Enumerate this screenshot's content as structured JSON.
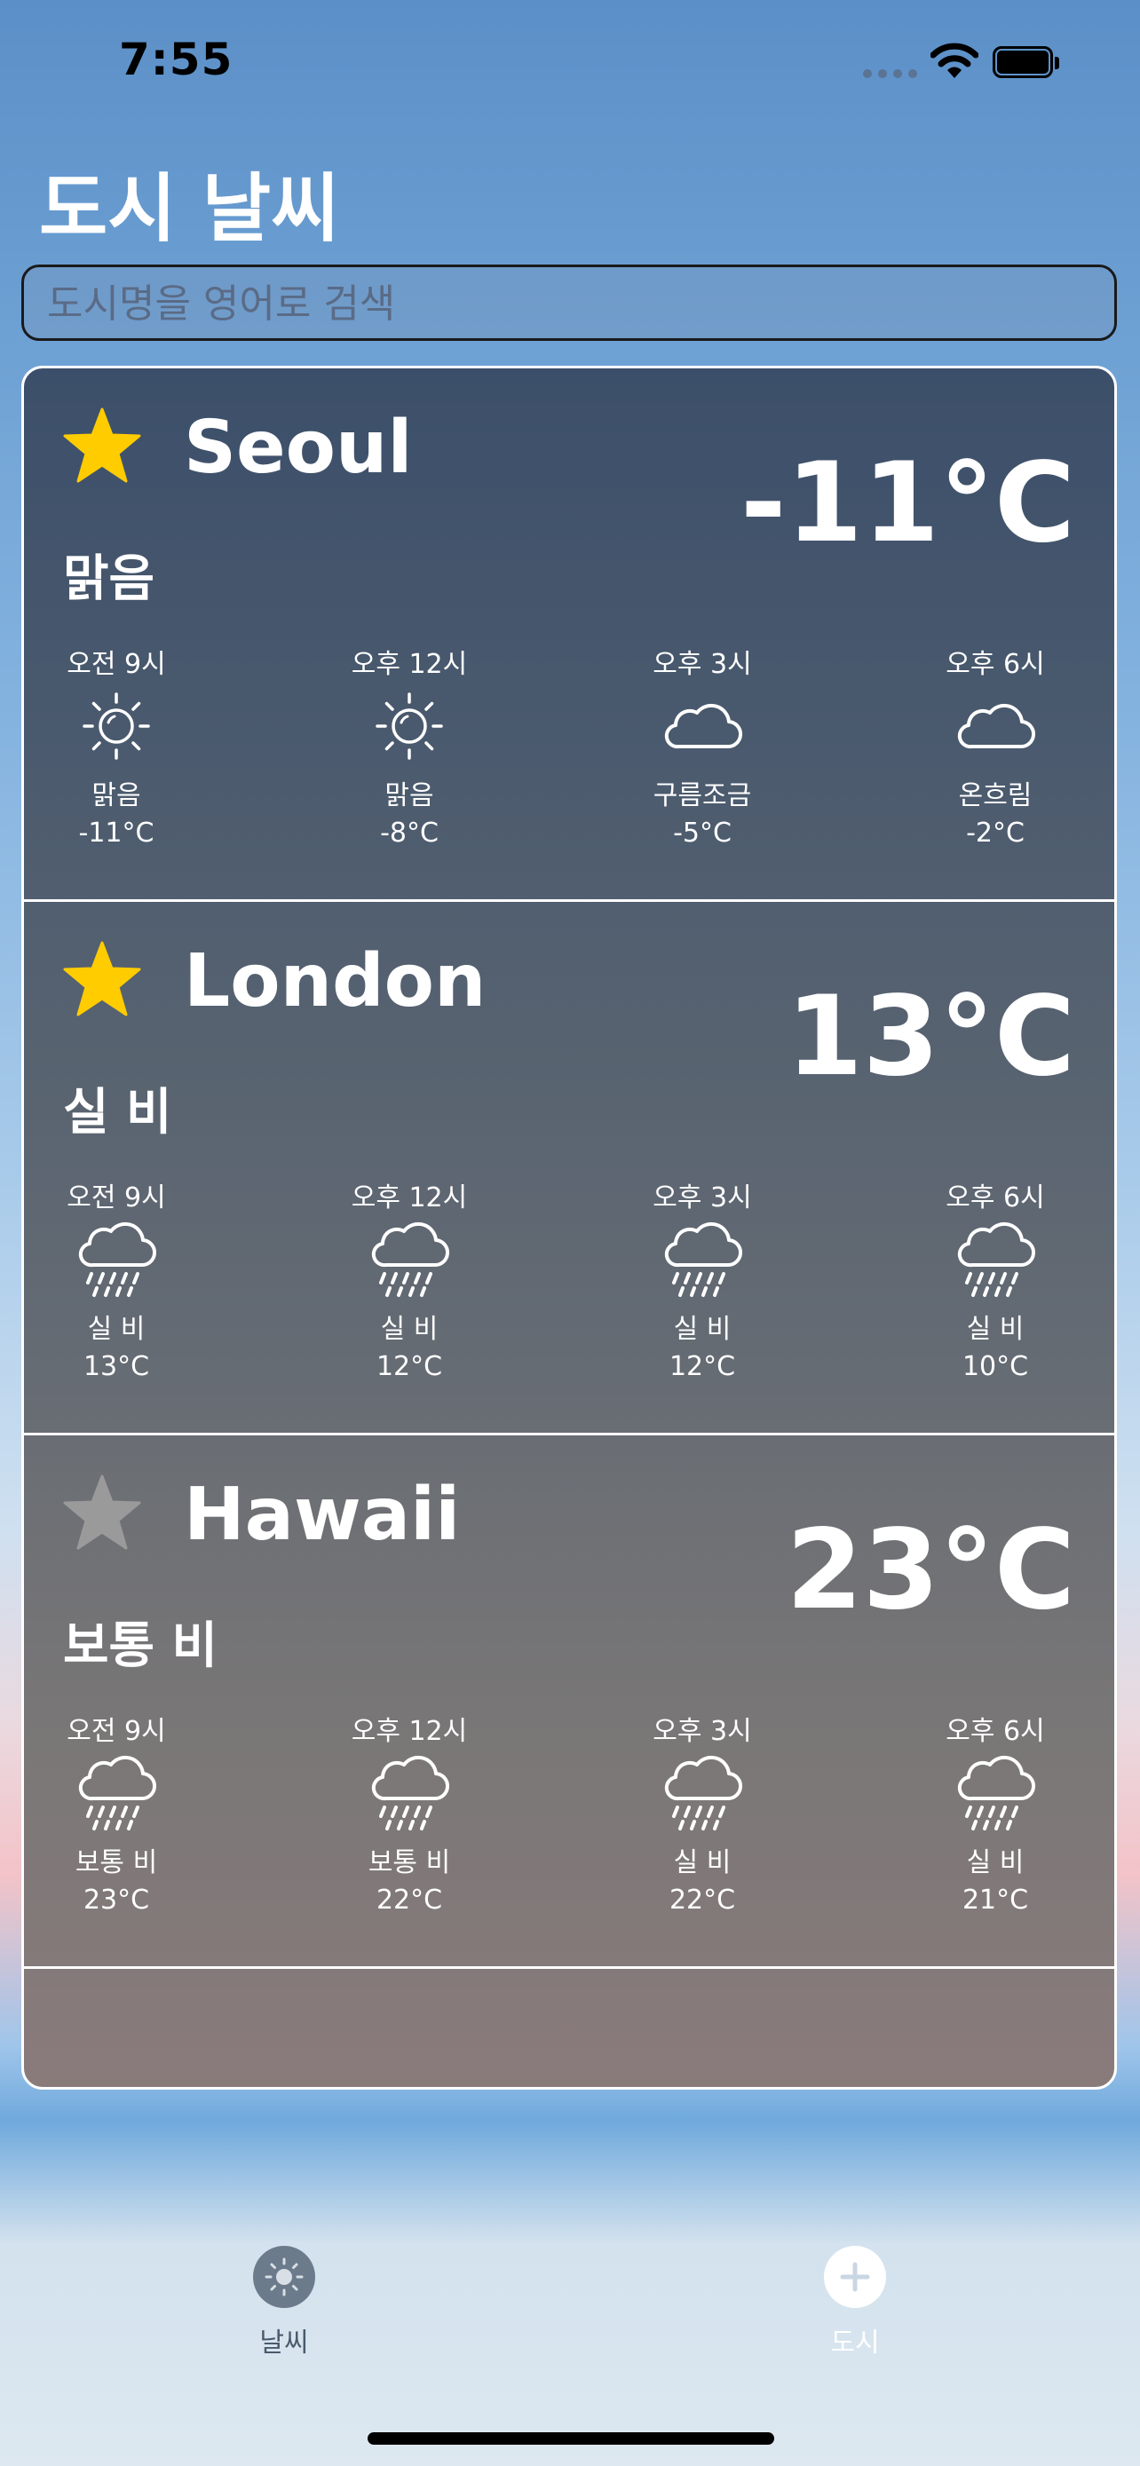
{
  "status": {
    "time": "7:55"
  },
  "header": {
    "title": "도시 날씨"
  },
  "search": {
    "placeholder": "도시명을 영어로 검색"
  },
  "colors": {
    "star_active": "#FFCC00",
    "star_inactive": "#9a9a9a",
    "tab_active": "#ffffff",
    "tab_inactive": "#6b7b8c"
  },
  "cities": [
    {
      "name": "Seoul",
      "favorite": true,
      "temp": "-11°C",
      "condition": "맑음",
      "hours": [
        {
          "time": "오전 9시",
          "icon": "sun-icon",
          "desc": "맑음",
          "temp": "-11°C"
        },
        {
          "time": "오후 12시",
          "icon": "sun-icon",
          "desc": "맑음",
          "temp": "-8°C"
        },
        {
          "time": "오후 3시",
          "icon": "cloud-icon",
          "desc": "구름조금",
          "temp": "-5°C"
        },
        {
          "time": "오후 6시",
          "icon": "cloud-icon",
          "desc": "온흐림",
          "temp": "-2°C"
        }
      ]
    },
    {
      "name": "London",
      "favorite": true,
      "temp": "13°C",
      "condition": "실 비",
      "hours": [
        {
          "time": "오전 9시",
          "icon": "rain-icon",
          "desc": "실 비",
          "temp": "13°C"
        },
        {
          "time": "오후 12시",
          "icon": "rain-icon",
          "desc": "실 비",
          "temp": "12°C"
        },
        {
          "time": "오후 3시",
          "icon": "rain-icon",
          "desc": "실 비",
          "temp": "12°C"
        },
        {
          "time": "오후 6시",
          "icon": "rain-icon",
          "desc": "실 비",
          "temp": "10°C"
        }
      ]
    },
    {
      "name": "Hawaii",
      "favorite": false,
      "temp": "23°C",
      "condition": "보통 비",
      "hours": [
        {
          "time": "오전 9시",
          "icon": "rain-icon",
          "desc": "보통 비",
          "temp": "23°C"
        },
        {
          "time": "오후 12시",
          "icon": "rain-icon",
          "desc": "보통 비",
          "temp": "22°C"
        },
        {
          "time": "오후 3시",
          "icon": "rain-icon",
          "desc": "실 비",
          "temp": "22°C"
        },
        {
          "time": "오후 6시",
          "icon": "rain-icon",
          "desc": "실 비",
          "temp": "21°C"
        }
      ]
    }
  ],
  "tabbar": {
    "weather": {
      "label": "날씨",
      "icon": "sun-icon",
      "selected": false
    },
    "city": {
      "label": "도시",
      "icon": "plus-icon",
      "selected": true
    }
  }
}
